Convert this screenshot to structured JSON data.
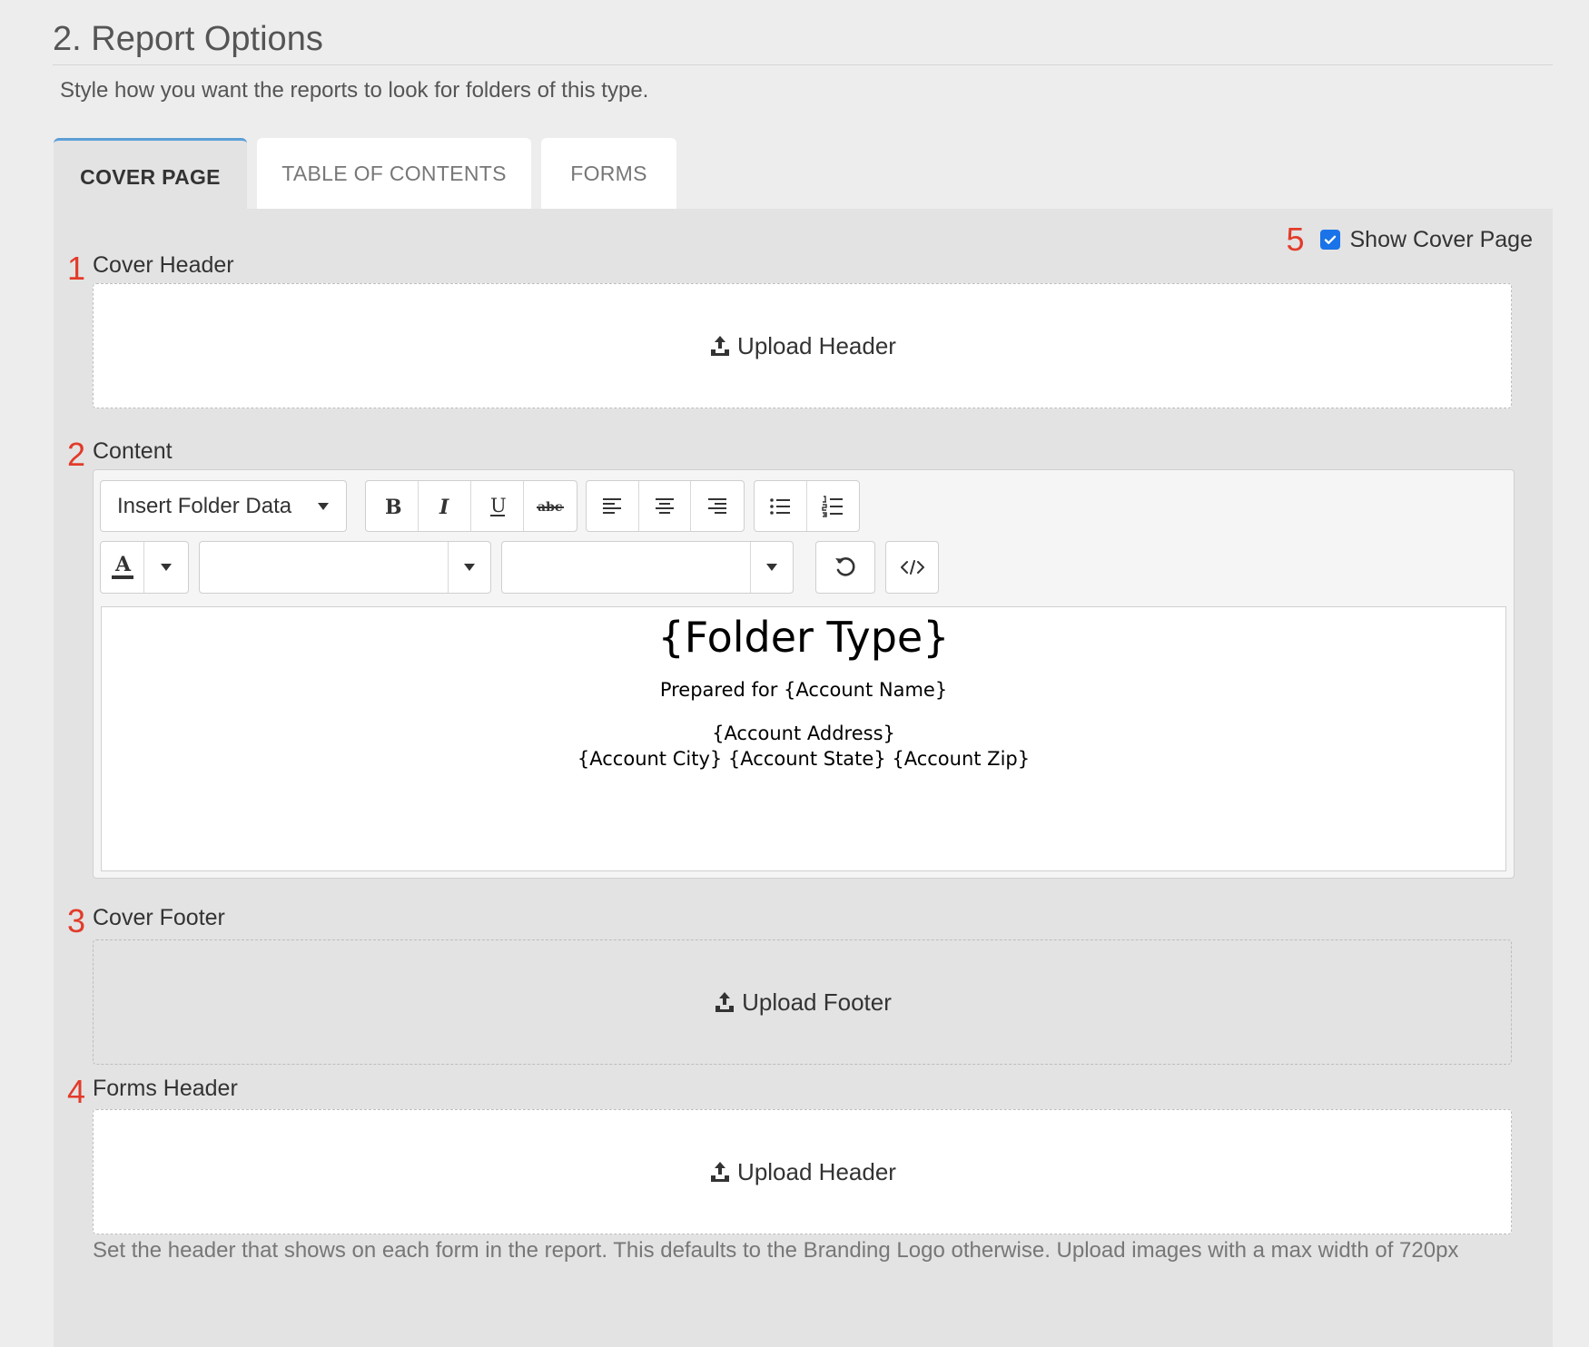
{
  "section": {
    "title": "2. Report Options",
    "subtitle": "Style how you want the reports to look for folders of this type."
  },
  "tabs": [
    {
      "label": "COVER PAGE",
      "active": true
    },
    {
      "label": "TABLE OF CONTENTS",
      "active": false
    },
    {
      "label": "FORMS",
      "active": false
    }
  ],
  "show_cover": {
    "number": "5",
    "label": "Show Cover Page",
    "checked": true
  },
  "cover_header": {
    "number": "1",
    "label": "Cover Header",
    "upload_label": "Upload Header"
  },
  "content": {
    "number": "2",
    "label": "Content",
    "insert_dropdown": "Insert Folder Data",
    "font_family_value": "",
    "font_size_value": "",
    "body": {
      "heading": "{Folder Type}",
      "prepared": "Prepared for {Account Name}",
      "address": "{Account Address}",
      "city_line": "{Account City} {Account State} {Account Zip}"
    }
  },
  "cover_footer": {
    "number": "3",
    "label": "Cover Footer",
    "upload_label": "Upload Footer"
  },
  "forms_header": {
    "number": "4",
    "label": "Forms Header",
    "upload_label": "Upload Header",
    "help": "Set the header that shows on each form in the report. This defaults to the Branding Logo otherwise. Upload images with a max width of 720px"
  },
  "icons": [
    "upload-icon",
    "bold-icon",
    "italic-icon",
    "underline-icon",
    "strikethrough-icon",
    "align-left-icon",
    "align-center-icon",
    "align-right-icon",
    "bullet-list-icon",
    "numbered-list-icon",
    "font-color-icon",
    "undo-icon",
    "code-view-icon",
    "caret-down-icon",
    "checkmark-icon"
  ],
  "colors": {
    "accent": "#5b9fd6",
    "number": "#e23b2a",
    "checkbox": "#1a73e8",
    "panel": "#e3e3e3"
  }
}
